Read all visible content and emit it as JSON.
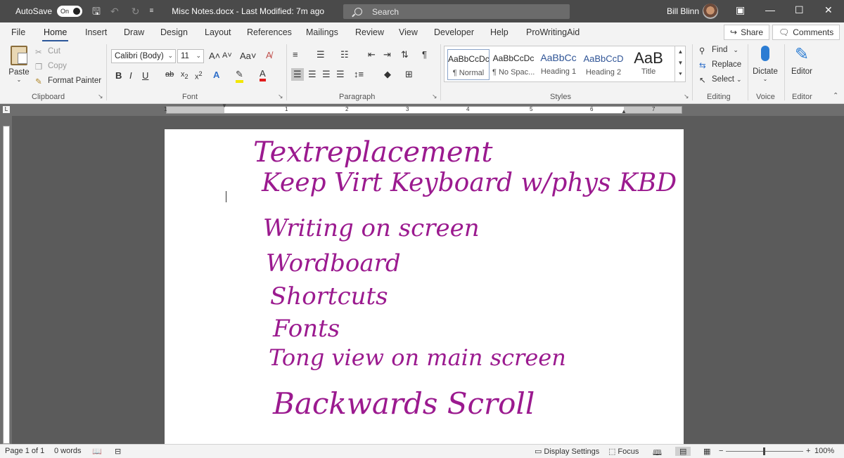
{
  "titlebar": {
    "autosave_label": "AutoSave",
    "autosave_state": "On",
    "doc_title": "Misc Notes.docx  -  Last Modified: 7m ago",
    "search_placeholder": "Search",
    "user_name": "Bill Blinn"
  },
  "tabs": [
    "File",
    "Home",
    "Insert",
    "Draw",
    "Design",
    "Layout",
    "References",
    "Mailings",
    "Review",
    "View",
    "Developer",
    "Help",
    "ProWritingAid"
  ],
  "active_tab": "Home",
  "share_label": "Share",
  "comments_label": "Comments",
  "clipboard": {
    "paste": "Paste",
    "cut": "Cut",
    "copy": "Copy",
    "format_painter": "Format Painter",
    "label": "Clipboard"
  },
  "font": {
    "name": "Calibri (Body)",
    "size": "11",
    "label": "Font"
  },
  "paragraph": {
    "label": "Paragraph"
  },
  "styles": {
    "label": "Styles",
    "items": [
      {
        "preview": "AaBbCcDc",
        "name": "¶ Normal"
      },
      {
        "preview": "AaBbCcDc",
        "name": "¶ No Spac..."
      },
      {
        "preview": "AaBbCc",
        "name": "Heading 1"
      },
      {
        "preview": "AaBbCcD",
        "name": "Heading 2"
      },
      {
        "preview": "AaB",
        "name": "Title"
      }
    ]
  },
  "editing": {
    "find": "Find",
    "replace": "Replace",
    "select": "Select",
    "label": "Editing"
  },
  "voice": {
    "dictate": "Dictate",
    "label": "Voice"
  },
  "editor": {
    "editor": "Editor",
    "label": "Editor"
  },
  "ruler": {
    "numbers": [
      "1",
      "1",
      "2",
      "3",
      "4",
      "5",
      "6",
      "7"
    ]
  },
  "ink_lines": [
    "Textreplacement",
    "Keep Virt Keyboard w/phys KBD",
    "Writing on screen",
    "Wordboard",
    "Shortcuts",
    "Fonts",
    "Tong view on main screen",
    "Backwards Scroll"
  ],
  "ink_color": "#9b1a8f",
  "status": {
    "page": "Page 1 of 1",
    "words": "0 words",
    "display_settings": "Display Settings",
    "focus": "Focus",
    "zoom": "100%"
  }
}
